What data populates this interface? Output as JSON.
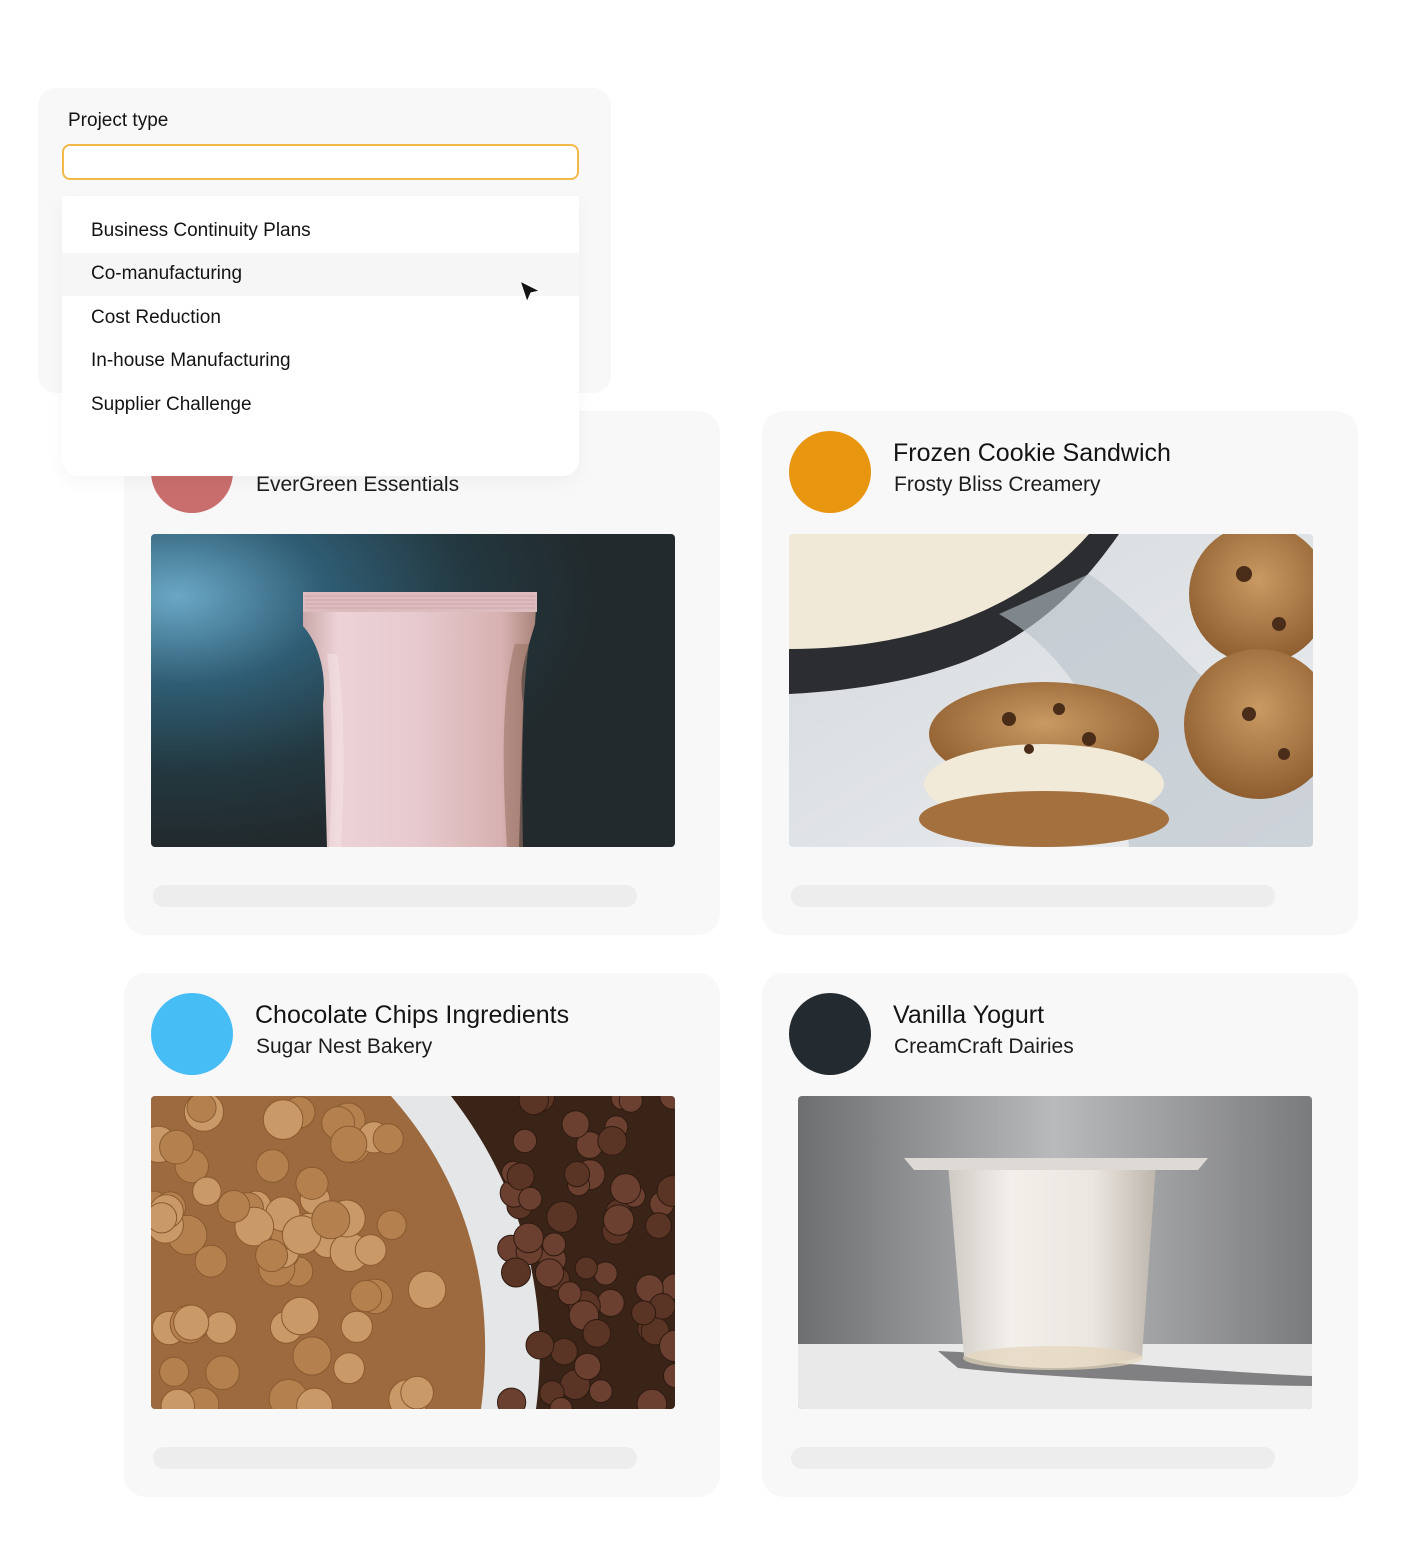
{
  "project_type": {
    "label": "Project type",
    "value": "",
    "options": [
      "Business Continuity Plans",
      "Co-manufacturing",
      "Cost Reduction",
      "In-house Manufacturing",
      "Supplier Challenge"
    ],
    "hovered_option": "Co-manufacturing"
  },
  "cards": [
    {
      "title": "",
      "subtitle": "EverGreen Essentials",
      "color": "#c96e6c",
      "image": "pink-pouch-photo"
    },
    {
      "title": "Frozen Cookie Sandwich",
      "subtitle": "Frosty Bliss Creamery",
      "color": "#e8950f",
      "image": "ice-cream-cookie-sandwich-photo"
    },
    {
      "title": "Chocolate Chips Ingredients",
      "subtitle": "Sugar Nest Bakery",
      "color": "#47bdf6",
      "image": "chocolate-chips-photo"
    },
    {
      "title": "Vanilla Yogurt",
      "subtitle": "CreamCraft Dairies",
      "color": "#242b30",
      "image": "yogurt-cup-photo"
    }
  ]
}
